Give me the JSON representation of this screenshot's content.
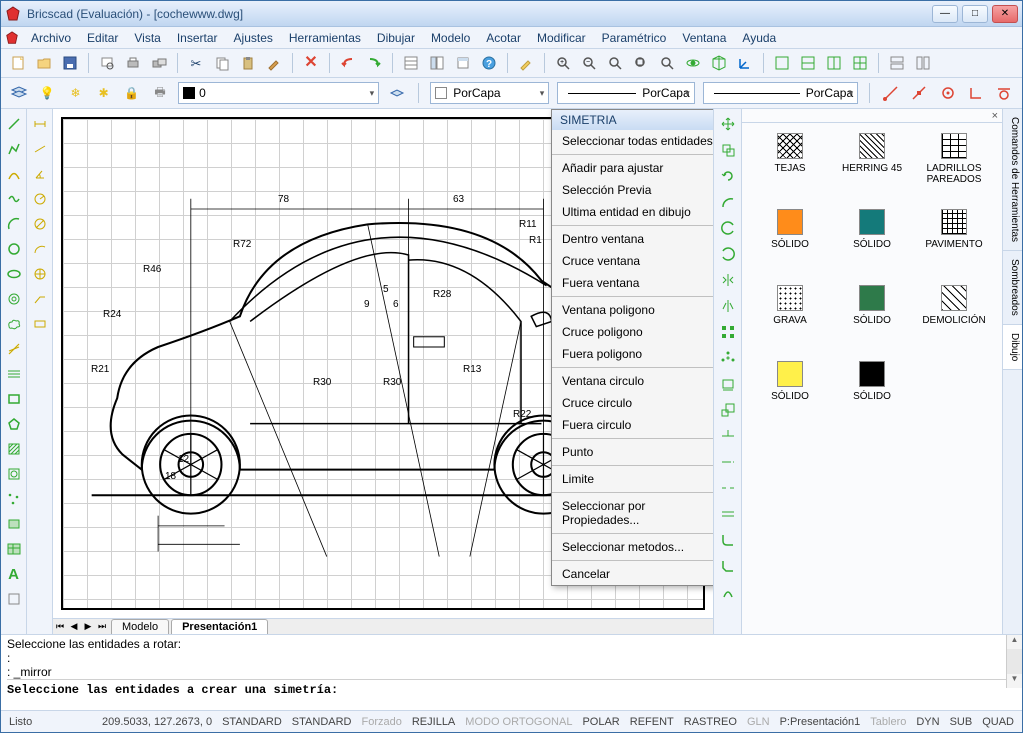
{
  "window": {
    "title": "Bricscad (Evaluación) - [cochewww.dwg]"
  },
  "menubar": {
    "items": [
      "Archivo",
      "Editar",
      "Vista",
      "Insertar",
      "Ajustes",
      "Herramientas",
      "Dibujar",
      "Modelo",
      "Acotar",
      "Modificar",
      "Paramétrico",
      "Ventana",
      "Ayuda"
    ]
  },
  "properties": {
    "layer_value": "0",
    "color_combo": "PorCapa",
    "linetype_combo": "PorCapa",
    "lineweight_combo": "PorCapa"
  },
  "tabs": {
    "model": "Modelo",
    "layout1": "Presentación1"
  },
  "context_menu": {
    "header": "SIMETRIA",
    "select_all": "Seleccionar todas entidades",
    "add_fit": "Añadir para ajustar",
    "prev_sel": "Selección Previa",
    "last_ent": "Ultima entidad en dibujo",
    "in_window": "Dentro ventana",
    "cross_window": "Cruce ventana",
    "out_window": "Fuera ventana",
    "poly_win": "Ventana poligono",
    "poly_cross": "Cruce poligono",
    "poly_out": "Fuera poligono",
    "circ_win": "Ventana circulo",
    "circ_cross": "Cruce circulo",
    "circ_out": "Fuera circulo",
    "point": "Punto",
    "limit": "Limite",
    "sel_props": "Seleccionar por Propiedades...",
    "sel_methods": "Seleccionar metodos...",
    "cancel": "Cancelar"
  },
  "dimensions": {
    "d78": "78",
    "d63": "63",
    "r72": "R72",
    "r46": "R46",
    "r24": "R24",
    "r21": "R21",
    "r11": "R11",
    "r1": "R1",
    "r30a": "R30",
    "r30b": "R30",
    "r28": "R28",
    "r13": "R13",
    "r22": "R22",
    "d12": "12",
    "d18": "18",
    "s5": "5",
    "s9": "9",
    "s6": "6"
  },
  "hatch_panel": {
    "items": [
      {
        "label": "TEJAS",
        "style": "background:#fff;background-image:repeating-linear-gradient(45deg,#000 0 1px,transparent 1px 5px),repeating-linear-gradient(-45deg,#000 0 1px,transparent 1px 5px);"
      },
      {
        "label": "HERRING 45",
        "style": "background:#fff;background-image:repeating-linear-gradient(45deg,#000 0 1px,transparent 1px 4px);"
      },
      {
        "label": "LADRILLOS PAREADOS",
        "style": "background:#fff;background-image:repeating-linear-gradient(0deg,#000 0 1px,transparent 1px 6px),repeating-linear-gradient(90deg,#000 0 1px,transparent 1px 8px);"
      },
      {
        "label": "SÓLIDO",
        "style": "background:#ff8c1a;"
      },
      {
        "label": "SÓLIDO",
        "style": "background:#147a7a;"
      },
      {
        "label": "PAVIMENTO",
        "style": "background:#fff;background-image:repeating-linear-gradient(0deg,#000 0 1px,transparent 1px 5px),repeating-linear-gradient(90deg,#000 0 1px,transparent 1px 5px);"
      },
      {
        "label": "GRAVA",
        "style": "background:#fff;background-image:radial-gradient(#000 1px,transparent 1px);background-size:5px 5px;"
      },
      {
        "label": "SÓLIDO",
        "style": "background:#2e7a4a;"
      },
      {
        "label": "DEMOLICIÓN",
        "style": "background:#fff;background-image:repeating-linear-gradient(45deg,#000 0 1px,transparent 1px 6px);"
      },
      {
        "label": "SÓLIDO",
        "style": "background:#fff04a;"
      },
      {
        "label": "SÓLIDO",
        "style": "background:#000;"
      }
    ]
  },
  "vtabs": {
    "tools": "Comandos de Herramientas",
    "hatch": "Sombreados",
    "draw": "Dibujo"
  },
  "commandline": {
    "l1": "Seleccione las entidades a rotar:",
    "l2": ":",
    "l3": ": _mirror",
    "prompt": "Seleccione las entidades a crear una simetría:"
  },
  "statusbar": {
    "ready": "Listo",
    "coords": "209.5033, 127.2673, 0",
    "standard1": "STANDARD",
    "standard2": "STANDARD",
    "forzado": "Forzado",
    "rejilla": "REJILLA",
    "ortho": "MODO ORTOGONAL",
    "polar": "POLAR",
    "refent": "REFENT",
    "rastreo": "RASTREO",
    "gln": "GLN",
    "layout": "P:Presentación1",
    "tablero": "Tablero",
    "dyn": "DYN",
    "sub": "SUB",
    "quad": "QUAD"
  },
  "icons": {
    "search": "?"
  }
}
